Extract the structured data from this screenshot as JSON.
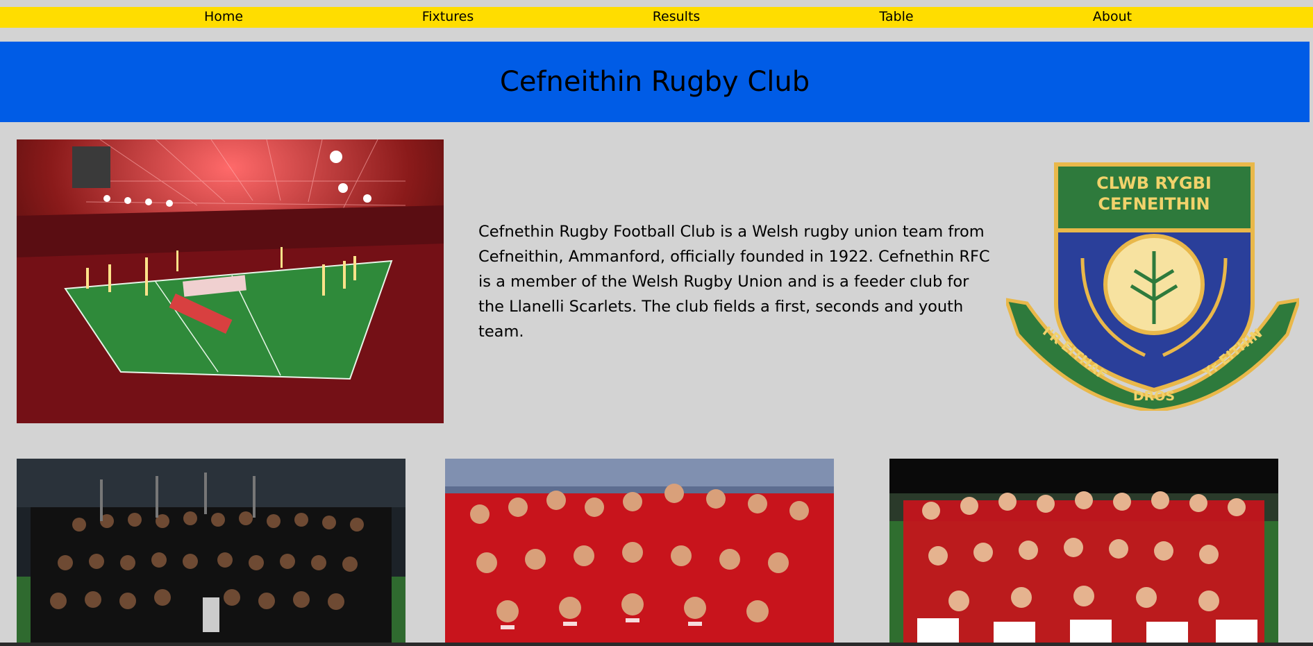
{
  "nav": {
    "items": [
      {
        "label": "Home"
      },
      {
        "label": "Fixtures"
      },
      {
        "label": "Results"
      },
      {
        "label": "Table"
      },
      {
        "label": "About"
      }
    ]
  },
  "header": {
    "title": "Cefneithin Rugby Club"
  },
  "intro": {
    "text": "Cefnethin Rugby Football Club is a Welsh rugby union team from Cefneithin, Ammanford, officially founded in 1922. Cefnethin RFC is a member of the Welsh Rugby Union and is a feeder club for the Llanelli Scarlets. The club fields a first, seconds and youth team."
  },
  "crest": {
    "top_line": "CLWB RYGBI",
    "second_line": "CEFNEITHIN",
    "motto_left": "I'R EITHAF",
    "motto_center": "DROS",
    "motto_right": "Yr EITHIN"
  },
  "colors": {
    "nav_bg": "#ffdd00",
    "banner_bg": "#005ce6",
    "page_bg": "#d3d3d3",
    "crest_green": "#2e7a3c",
    "crest_blue": "#2a3f9a",
    "crest_gold": "#e9b84a"
  },
  "images": [
    {
      "icon": "stadium-photo"
    },
    {
      "icon": "all-blacks-team-photo"
    },
    {
      "icon": "wales-celebration-photo"
    },
    {
      "icon": "wales-u20-team-photo"
    }
  ]
}
